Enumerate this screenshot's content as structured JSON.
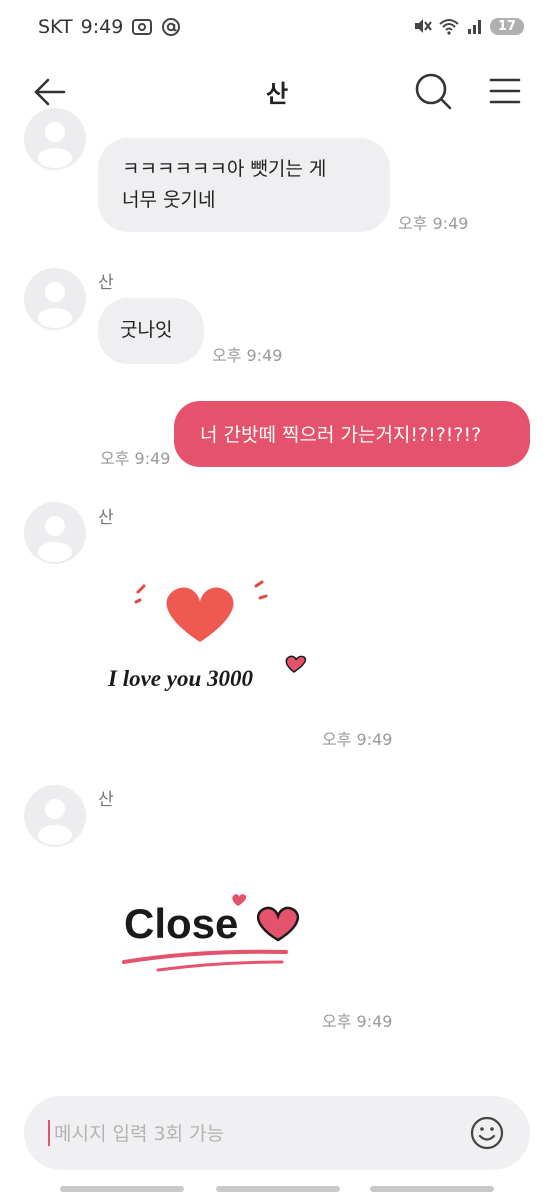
{
  "status_bar": {
    "carrier": "SKT",
    "time": "9:49",
    "battery": "17"
  },
  "header": {
    "title": "산"
  },
  "input": {
    "placeholder": "메시지 입력 3회 가능"
  },
  "messages": [
    {
      "type": "received",
      "lines": [
        "ㅋㅋㅋㅋㅋㅋ아 뺏기는 게",
        "너무 웃기네"
      ],
      "time": "오후 9:49"
    },
    {
      "type": "received",
      "sender": "산",
      "text": "굿나잇",
      "time": "오후 9:49"
    },
    {
      "type": "sent",
      "text": "너 간밧떼 찍으러 가는거지!?!?!?!?",
      "time": "오후 9:49"
    },
    {
      "type": "received",
      "sender": "산",
      "sticker": "heart-i-love-you-3000",
      "sticker_text": "I love you 3000",
      "time": "오후 9:49"
    },
    {
      "type": "received",
      "sender": "산",
      "sticker": "close-heart",
      "sticker_text": "Close",
      "time": "오후 9:49"
    }
  ],
  "colors": {
    "accent": "#e5526b",
    "bubble_received": "#efeff2",
    "heart": "#ee5a4f"
  }
}
